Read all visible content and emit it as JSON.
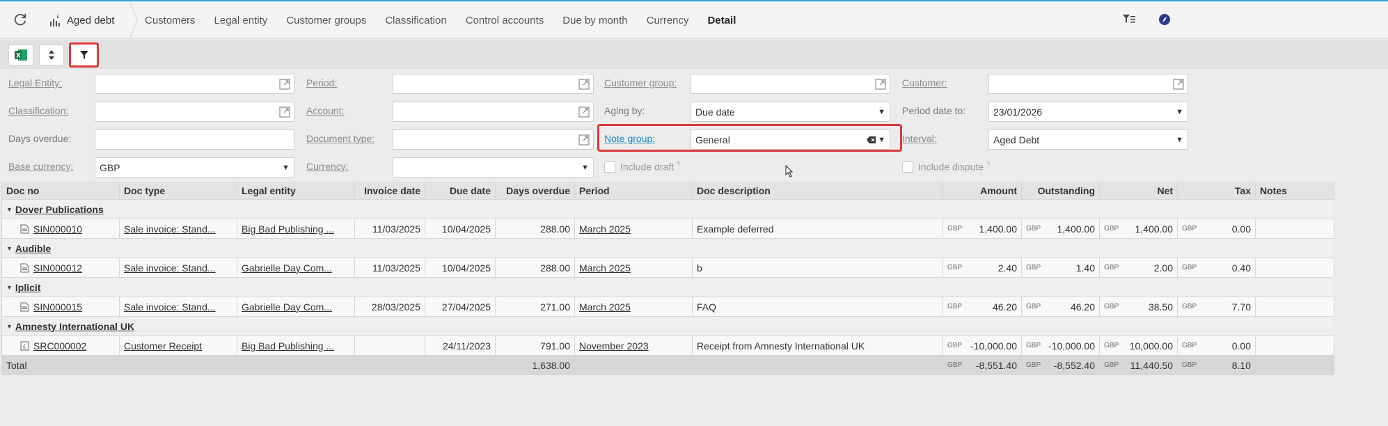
{
  "nav": {
    "app_title": "Aged debt",
    "tabs": [
      "Customers",
      "Legal entity",
      "Customer groups",
      "Classification",
      "Control accounts",
      "Due by month",
      "Currency",
      "Detail"
    ],
    "active_tab": "Detail"
  },
  "filters": {
    "legal_entity": {
      "label": "Legal Entity:",
      "value": ""
    },
    "period": {
      "label": "Period:",
      "value": ""
    },
    "customer_group": {
      "label": "Customer group:",
      "value": ""
    },
    "customer": {
      "label": "Customer:",
      "value": ""
    },
    "classification": {
      "label": "Classification:",
      "value": ""
    },
    "account": {
      "label": "Account:",
      "value": ""
    },
    "aging_by": {
      "label": "Aging by:",
      "value": "Due date"
    },
    "period_date_to": {
      "label": "Period date to:",
      "value": "23/01/2026"
    },
    "days_overdue": {
      "label": "Days overdue:",
      "value": ""
    },
    "document_type": {
      "label": "Document type:",
      "value": ""
    },
    "note_group": {
      "label": "Note group:",
      "value": "General"
    },
    "interval": {
      "label": "Interval:",
      "value": "Aged Debt"
    },
    "base_currency": {
      "label": "Base currency:",
      "value": "GBP"
    },
    "currency": {
      "label": "Currency:",
      "value": ""
    },
    "include_draft": {
      "label": "Include draft",
      "hint": "?",
      "checked": false
    },
    "include_dispute": {
      "label": "Include dispute",
      "hint": "?",
      "checked": false
    }
  },
  "grid": {
    "columns": [
      "Doc no",
      "Doc type",
      "Legal entity",
      "Invoice date",
      "Due date",
      "Days overdue",
      "Period",
      "Doc description",
      "Amount",
      "Outstanding",
      "Net",
      "Tax",
      "Notes"
    ],
    "groups": [
      {
        "name": "Dover Publications",
        "rows": [
          {
            "doc_no": "SIN000010",
            "doc_type": "Sale invoice: Stand...",
            "legal_entity": "Big Bad Publishing ...",
            "invoice_date": "11/03/2025",
            "due_date": "10/04/2025",
            "days_overdue": "288.00",
            "period": "March 2025",
            "description": "Example deferred",
            "currency": "GBP",
            "amount": "1,400.00",
            "outstanding": "1,400.00",
            "net": "1,400.00",
            "tax": "0.00",
            "notes": ""
          }
        ]
      },
      {
        "name": "Audible",
        "rows": [
          {
            "doc_no": "SIN000012",
            "doc_type": "Sale invoice: Stand...",
            "legal_entity": "Gabrielle Day Com...",
            "invoice_date": "11/03/2025",
            "due_date": "10/04/2025",
            "days_overdue": "288.00",
            "period": "March 2025",
            "description": "b",
            "currency": "GBP",
            "amount": "2.40",
            "outstanding": "1.40",
            "net": "2.00",
            "tax": "0.40",
            "notes": ""
          }
        ]
      },
      {
        "name": "Iplicit",
        "rows": [
          {
            "doc_no": "SIN000015",
            "doc_type": "Sale invoice: Stand...",
            "legal_entity": "Gabrielle Day Com...",
            "invoice_date": "28/03/2025",
            "due_date": "27/04/2025",
            "days_overdue": "271.00",
            "period": "March 2025",
            "description": "FAQ",
            "currency": "GBP",
            "amount": "46.20",
            "outstanding": "46.20",
            "net": "38.50",
            "tax": "7.70",
            "notes": ""
          }
        ]
      },
      {
        "name": "Amnesty International UK",
        "rows": [
          {
            "doc_no": "SRC000002",
            "doc_type": "Customer Receipt",
            "legal_entity": "Big Bad Publishing ...",
            "invoice_date": "",
            "due_date": "24/11/2023",
            "days_overdue": "791.00",
            "period": "November 2023",
            "description": "Receipt from Amnesty International UK",
            "currency": "GBP",
            "amount": "-10,000.00",
            "outstanding": "-10,000.00",
            "net": "10,000.00",
            "tax": "0.00",
            "notes": ""
          }
        ]
      }
    ],
    "total": {
      "label": "Total",
      "days_overdue": "1,638.00",
      "currency": "GBP",
      "amount": "-8,551.40",
      "outstanding": "-8,552.40",
      "net": "11,440.50",
      "tax": "8.10"
    }
  },
  "colors": {
    "accent": "#2aa8d8",
    "highlight": "#d93a3a",
    "link": "#1a8ac4",
    "excel_green": "#1e7145"
  }
}
